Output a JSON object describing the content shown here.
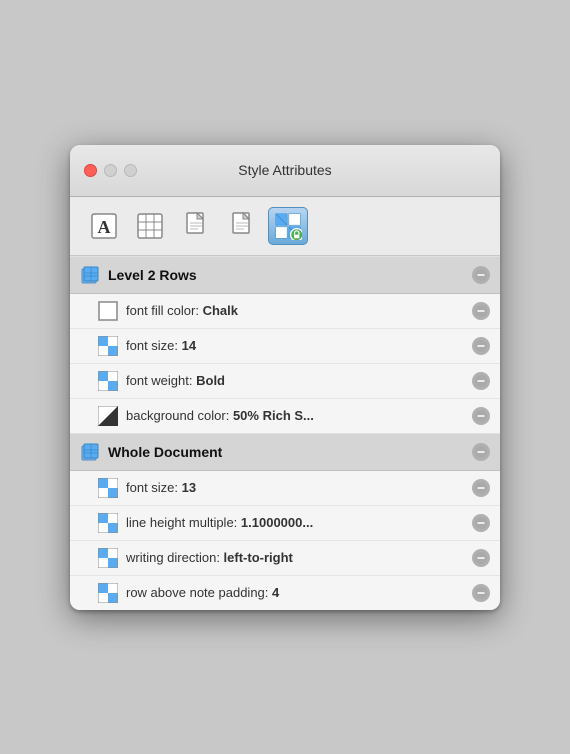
{
  "window": {
    "title": "Style Attributes"
  },
  "toolbar": {
    "buttons": [
      {
        "id": "text",
        "label": "Text",
        "active": false
      },
      {
        "id": "table",
        "label": "Table",
        "active": false
      },
      {
        "id": "doc1",
        "label": "Document1",
        "active": false
      },
      {
        "id": "doc2",
        "label": "Document2",
        "active": false
      },
      {
        "id": "style",
        "label": "Style",
        "active": true
      }
    ]
  },
  "sections": [
    {
      "id": "level2rows",
      "title": "Level 2 Rows",
      "attributes": [
        {
          "icon": "white-square",
          "text": "font fill color: ",
          "bold": "Chalk"
        },
        {
          "icon": "blue-checker",
          "text": "font size: ",
          "bold": "14"
        },
        {
          "icon": "blue-checker",
          "text": "font weight: ",
          "bold": "Bold"
        },
        {
          "icon": "diagonal",
          "text": "background color: ",
          "bold": "50% Rich S..."
        }
      ]
    },
    {
      "id": "wholedoc",
      "title": "Whole Document",
      "attributes": [
        {
          "icon": "blue-checker",
          "text": "font size: ",
          "bold": "13"
        },
        {
          "icon": "blue-checker",
          "text": "line height multiple: ",
          "bold": "1.1000000..."
        },
        {
          "icon": "blue-checker",
          "text": "writing direction: ",
          "bold": "left-to-right"
        },
        {
          "icon": "blue-checker",
          "text": "row above note padding: ",
          "bold": "4"
        }
      ]
    }
  ]
}
